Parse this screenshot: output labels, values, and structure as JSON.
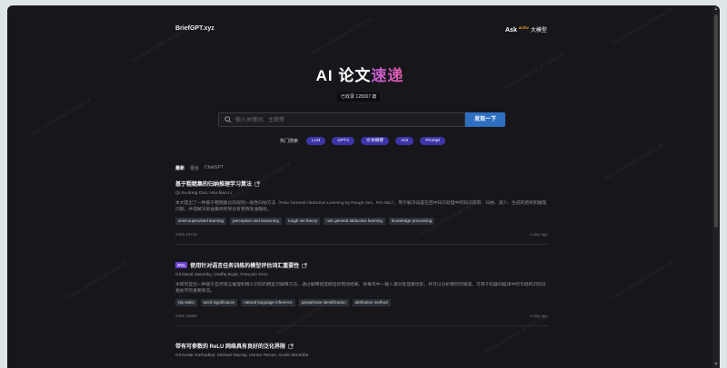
{
  "header": {
    "brand": "BriefGPT.xyz",
    "ask": "Ask",
    "ask_arxiv": "arXiv",
    "ask_llm": "大模型"
  },
  "hero": {
    "title_main": "AI 论文",
    "title_accent": "速递",
    "count": "已收录 128307 篇"
  },
  "search": {
    "placeholder": "输入关键词、主题等",
    "button": "发现一下"
  },
  "hot": {
    "label": "热门搜索",
    "tags": [
      "LLM",
      "GPT4",
      "文本摘要",
      "AGI",
      "Prompt"
    ]
  },
  "tabs": [
    {
      "label": "最新",
      "active": true
    },
    {
      "label": "混合",
      "active": false
    },
    {
      "label": "ChatGPT",
      "active": false
    }
  ],
  "watermark": "Telegram@科技频道 原汁原味分享",
  "papers": [
    {
      "venue": "",
      "title": "基于粗糙集的归纳推理学习算法",
      "authors": "Qi Xu-dong Guo, Hou-biao Li",
      "abstract": "本文提出了一种基于粗糙集论的规则一般性归纳方法（Rule General Abductive Learning by Rough Set，RS-ABL），用于解决误差在因中知识处理中的知识获取、归纳、减少、生成的结构和推理问题，并得解决到益最终所到达有更情性准确性。",
      "keywords": [
        "semi-supervised learning",
        "perception and reasoning",
        "rough set theory",
        "rule general abductive learning",
        "knowledge processing"
      ],
      "id": "2305.19718",
      "age": "a day ago"
    },
    {
      "venue": "ACL",
      "title": "使用针对语言任务训练的模型评估词汇重要性",
      "authors": "Gil David Javorsky, Ondřej Bojar, François Yvon",
      "abstract": "本研究提出一种基于自然语言推理和释义识别的模型可解释方法，通过解释我提模型的预测结果，将每句中一输入语对处理重性影，并可以分析哪则句输值，可用于机器扫描译中的句结构识别对相关字的重要情况。",
      "keywords": [
        "nlp tasks",
        "word significance",
        "natural language inference",
        "paraphrase identification",
        "attribution method"
      ],
      "id": "2305.15880",
      "age": "a day ago"
    },
    {
      "venue": "",
      "title": "带有可参数的 ReLU 网络具有良好的泛化界限",
      "authors": "Gil Kedar Karhadkar, Michael Murray, Hanna Tseran, Guido Montúfar"
    }
  ]
}
